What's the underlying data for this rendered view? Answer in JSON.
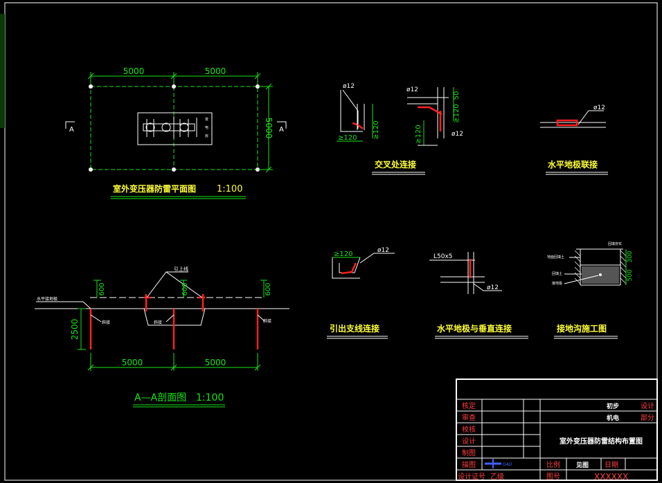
{
  "colors": {
    "background": "#000000",
    "line": "#ffffff",
    "dimension": "#19e619",
    "title": "#ffff33",
    "grounding": "#ff2020"
  },
  "plan": {
    "dim_left": "5000",
    "dim_right": "5000",
    "dim_height": "5000",
    "section_mark_left": "A",
    "section_mark_right": "A",
    "title": "室外变压器防雷平面图",
    "scale": "1:100"
  },
  "section": {
    "dim_depth": "2500",
    "dim_h1": "600",
    "dim_h2": "600",
    "dim_h3": "600",
    "dim_left": "5000",
    "dim_right": "5000",
    "label_ground_rod": "水平接地极",
    "label_lead": "引上线",
    "label_slope1": "斜接",
    "label_slope2": "斜接",
    "label_slope3": "斜接",
    "title": "A—A剖面图",
    "scale": "1:100"
  },
  "details": {
    "cross": {
      "title": "交叉处连接",
      "d1": "ø12",
      "d2": "≥120",
      "d3": "≥120",
      "d4": "ø12",
      "d5": "50",
      "d6": "≥120",
      "d7": "≥120",
      "d8": "ø12"
    },
    "horizontal": {
      "title": "水平地极联接",
      "d1": "ø12"
    },
    "lead": {
      "title": "引出支线连接",
      "d1": "≥120",
      "d2": "ø12"
    },
    "vertical": {
      "title": "水平地极与垂直连接",
      "d1": "L50x5",
      "d2": "ø12"
    },
    "trench": {
      "title": "接地沟施工图",
      "l1": "回填夯实",
      "l2": "地面回填土",
      "l3": "回填土",
      "l4": "接地极",
      "d1": "300",
      "d2": "500"
    }
  },
  "titleblock": {
    "rows": [
      "核定",
      "审查",
      "校核",
      "设计",
      "制图",
      "描图"
    ],
    "cert_label": "设计证号",
    "cert_value": "乙级",
    "stage_label": "初步",
    "stage_value": "设计",
    "dept_label": "机电",
    "dept_value": "部分",
    "drawing_title": "室外变压器防雷结构布置图",
    "ratio_label": "比例",
    "ratio_value": "见图",
    "date_label": "日期",
    "number_label": "图号",
    "number_value": "XXXXXX",
    "logo_text": "GAD"
  }
}
